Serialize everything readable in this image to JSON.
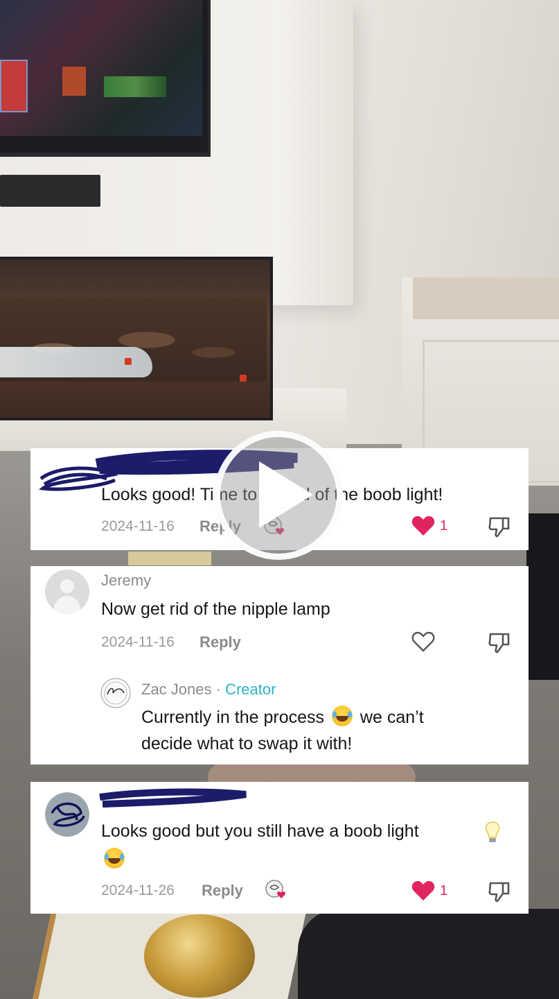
{
  "comments": [
    {
      "username": "",
      "text": "Looks good! Time to get rid of the boob light!",
      "date": "2024-11-16",
      "reply_label": "Reply",
      "liked_by_creator": true,
      "likes": "1",
      "heart_filled": true
    },
    {
      "username": "Jeremy",
      "text": "Now get rid of the nipple lamp",
      "date": "2024-11-16",
      "reply_label": "Reply",
      "liked_by_creator": false,
      "likes": "",
      "heart_filled": false,
      "reply": {
        "username": "Zac Jones",
        "separator": " · ",
        "badge": "Creator",
        "text_before_emoji": "Currently in the process",
        "emoji": "face-with-tears-of-joy",
        "text_after_emoji": "we can’t",
        "text_line2": "decide what to swap it with!"
      }
    },
    {
      "username": "",
      "text": "Looks good but you still have a boob light",
      "trailing_emoji": [
        "light-bulb",
        "face-with-tears-of-joy"
      ],
      "date": "2024-11-26",
      "reply_label": "Reply",
      "liked_by_creator": true,
      "likes": "1",
      "heart_filled": true
    }
  ],
  "colors": {
    "heart": "#e0245e",
    "creator_badge": "#2ab4c8",
    "card_bg": "#ffffff",
    "meta": "#9a9a9a"
  },
  "icons": {
    "play": "play-icon",
    "heart": "heart-icon",
    "dislike": "dislike-icon",
    "avatar_default": "default-avatar-icon"
  }
}
